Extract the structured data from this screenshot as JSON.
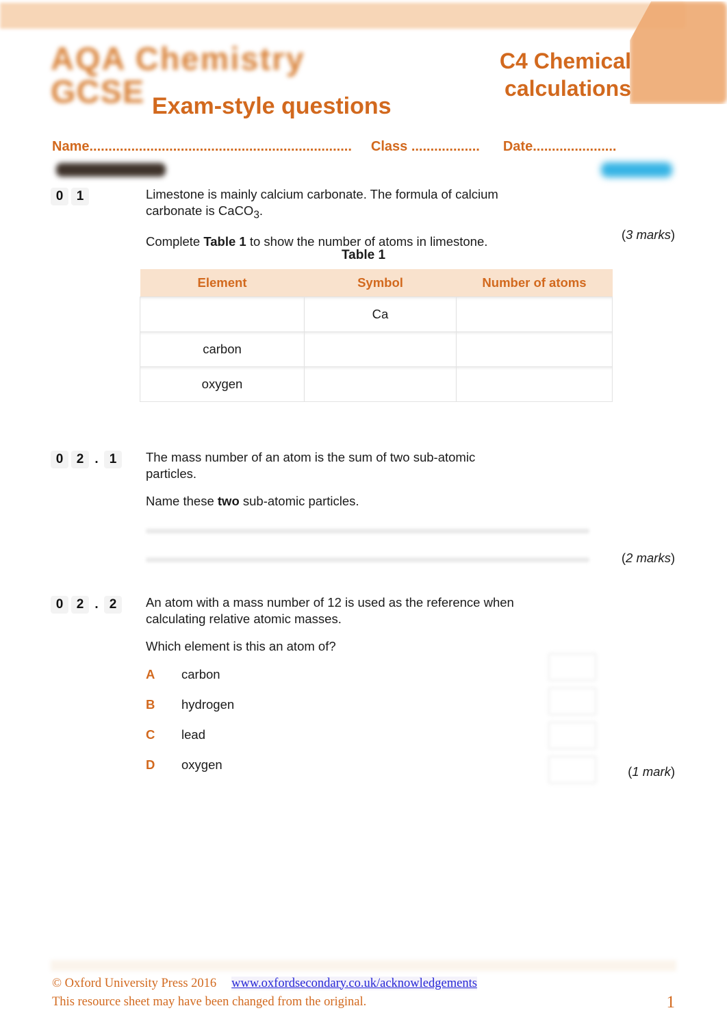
{
  "header": {
    "logo_line1": "AQA Chemistry",
    "logo_line2": "GCSE",
    "subtitle": "Exam-style questions",
    "title": "C4 Chemical calculations"
  },
  "name_class_date": {
    "name_label": "Name.....................................................................",
    "class_label": "Class ..................",
    "date_label": "Date......................"
  },
  "questions": {
    "q1": {
      "number": [
        "0",
        "1"
      ],
      "text_line1": "Limestone is mainly calcium carbonate. The formula of calcium",
      "text_line2_pre": "carbonate is CaCO",
      "text_line2_sub": "3",
      "text_line2_post": ".",
      "instruction_pre": "Complete ",
      "instruction_bold": "Table 1",
      "instruction_post": " to show the number of atoms in limestone.",
      "marks": "3 marks"
    },
    "q2_1": {
      "number": [
        "0",
        "2",
        ".",
        "1"
      ],
      "text_line1": "The mass number of an atom is the sum of two sub-atomic",
      "text_line2": "particles.",
      "instruction_pre": "Name these ",
      "instruction_bold": "two",
      "instruction_post": " sub-atomic particles.",
      "marks": "2 marks"
    },
    "q2_2": {
      "number": [
        "0",
        "2",
        ".",
        "2"
      ],
      "text_line1": "An atom with a mass number of 12 is used as the reference when",
      "text_line2": "calculating relative atomic masses.",
      "instruction": "Which element is this an atom of?",
      "marks": "1 mark",
      "options": [
        {
          "letter": "A",
          "label": "carbon"
        },
        {
          "letter": "B",
          "label": "hydrogen"
        },
        {
          "letter": "C",
          "label": "lead"
        },
        {
          "letter": "D",
          "label": "oxygen"
        }
      ]
    }
  },
  "table1": {
    "caption": "Table 1",
    "columns": [
      "Element",
      "Symbol",
      "Number of atoms"
    ],
    "rows": [
      {
        "element": "",
        "symbol": "Ca",
        "atoms": ""
      },
      {
        "element": "carbon",
        "symbol": "",
        "atoms": ""
      },
      {
        "element": "oxygen",
        "symbol": "",
        "atoms": ""
      }
    ]
  },
  "footer": {
    "copyright": "© Oxford University Press 2016",
    "url": "www.oxfordsecondary.co.uk/acknowledgements",
    "notice": "This resource sheet may have been changed from the original.",
    "page_number": "1"
  },
  "colors": {
    "accent_orange": "#d2691e",
    "header_band": "#f7d4b4",
    "corner_shape": "#eeab74",
    "table_header_bg": "#f9e2cd",
    "link_blue": "#2727d6",
    "redaction_dark": "#3f332b",
    "redaction_blue": "#36b4e5"
  }
}
